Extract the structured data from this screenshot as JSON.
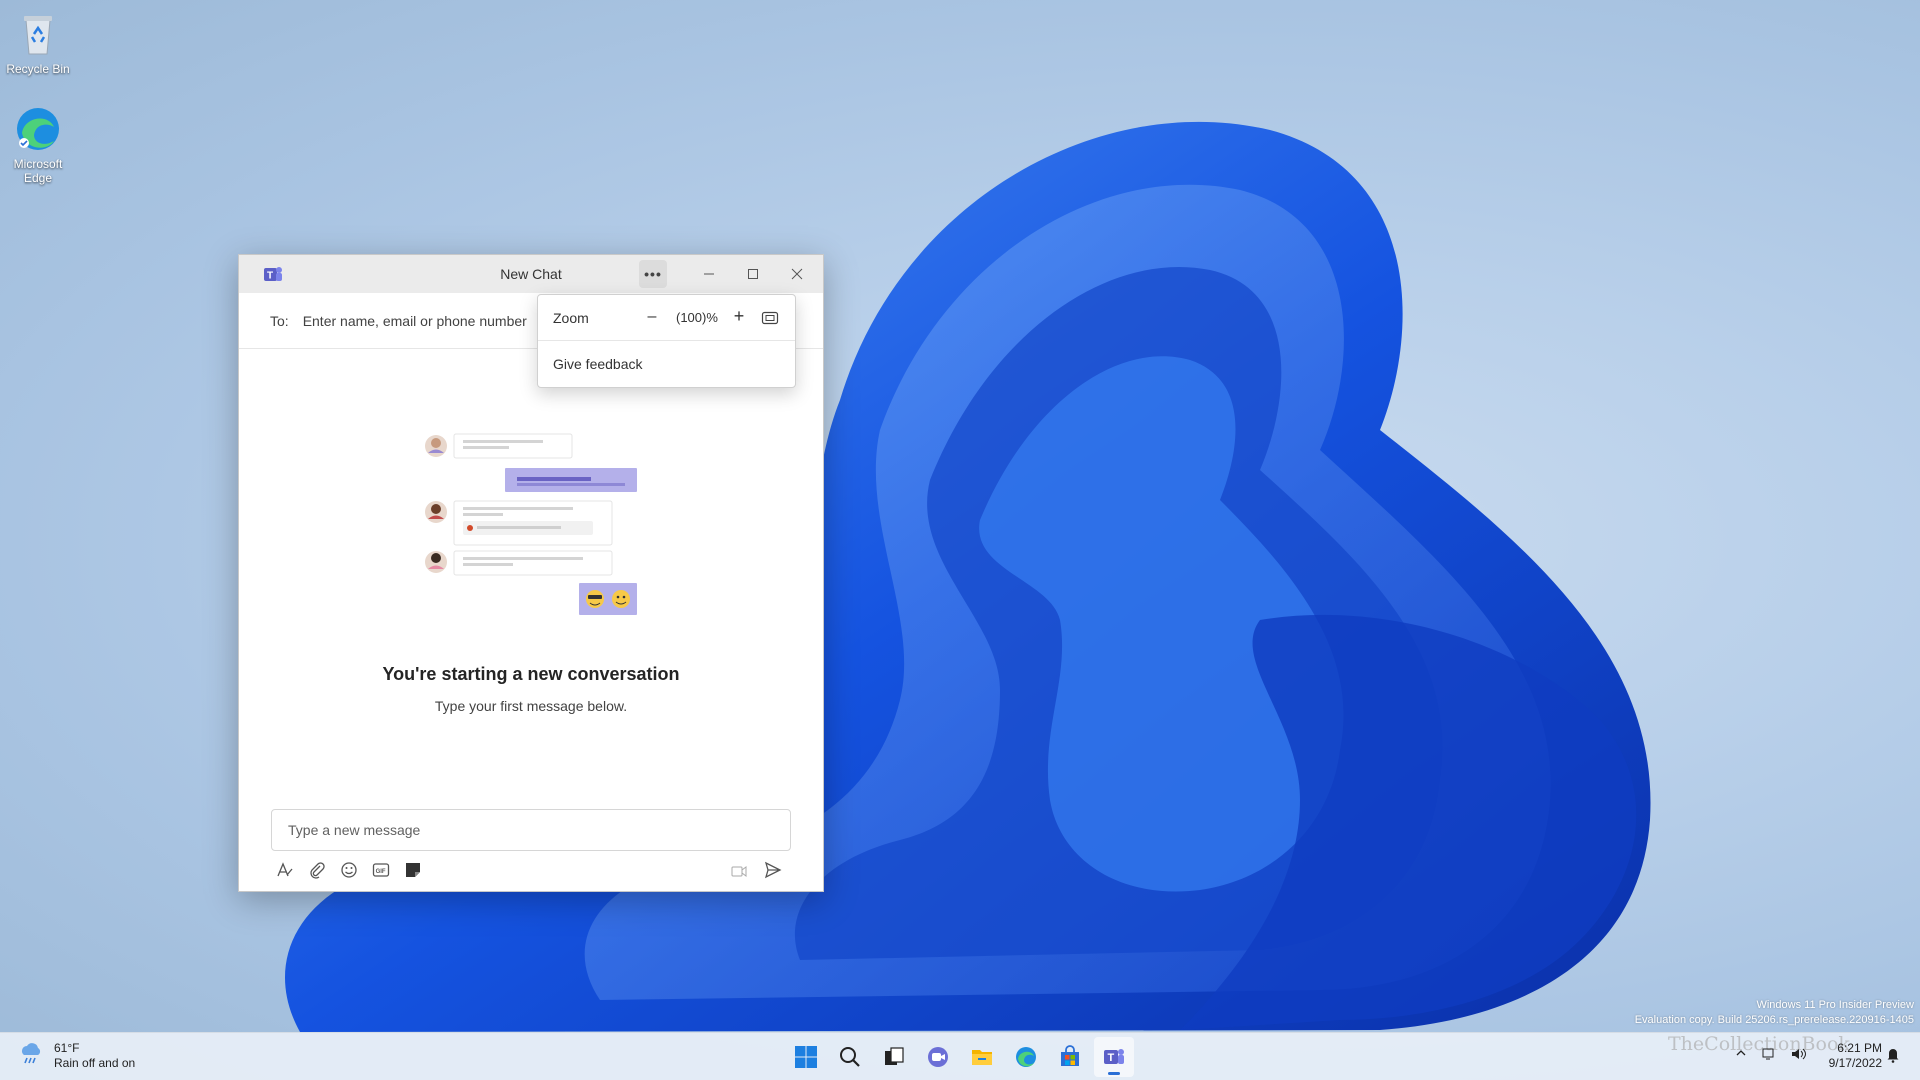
{
  "desktop": {
    "icons": [
      {
        "label": "Recycle Bin",
        "icon": "recycle-bin-icon"
      },
      {
        "label": "Microsoft Edge",
        "icon": "edge-icon"
      }
    ]
  },
  "window": {
    "title": "New Chat",
    "app_icon": "teams-icon",
    "more_label": "•••",
    "to_label": "To:",
    "to_placeholder": "Enter name, email or phone number",
    "headline": "You're starting a new conversation",
    "subline": "Type your first message below.",
    "compose_placeholder": "Type a new message",
    "tools": [
      "format-icon",
      "attach-icon",
      "emoji-icon",
      "gif-icon",
      "sticker-icon"
    ],
    "tools_right": [
      "schedule-icon",
      "send-icon"
    ]
  },
  "menu": {
    "zoom_label": "Zoom",
    "zoom_value": "(100)%",
    "feedback_label": "Give feedback"
  },
  "watermark": {
    "line1": "Windows 11 Pro Insider Preview",
    "line2": "Evaluation copy. Build 25206.rs_prerelease.220916-1405"
  },
  "taskbar": {
    "weather_temp": "61°F",
    "weather_desc": "Rain off and on",
    "apps": [
      "start-icon",
      "search-icon",
      "task-view-icon",
      "chat-icon",
      "file-explorer-icon",
      "edge-icon",
      "store-icon",
      "teams-icon"
    ],
    "active_app": "teams-icon",
    "time": "6:21 PM",
    "date": "9/17/2022",
    "brand": "TheCollectionBook"
  },
  "colors": {
    "accent": "#2a6fd6",
    "teams": "#5b5fc7",
    "bloom": "#1a5ae0"
  }
}
